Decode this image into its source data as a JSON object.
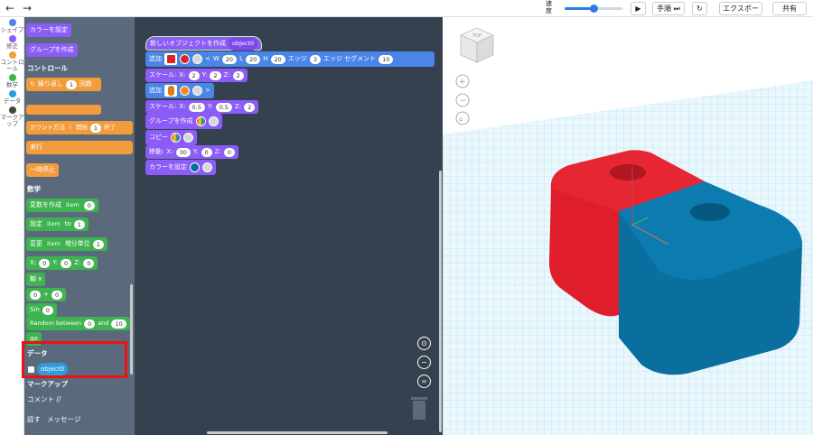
{
  "toolbar": {
    "undo_icon": "undo-arrow-icon",
    "redo_icon": "redo-arrow-icon",
    "speed_label": "速度",
    "speed_value": 0.5,
    "play_icon": "play-icon",
    "step_label": "手順",
    "reset_icon": "reset-icon",
    "export_label": "エクスポート",
    "share_label": "共有"
  },
  "sidebar": {
    "categories": [
      {
        "label": "シェイプ",
        "color": "#4a86e8"
      },
      {
        "label": "修正",
        "color": "#8b5cf6"
      },
      {
        "label": "コントロール",
        "color": "#f39c3c"
      },
      {
        "label": "数学",
        "color": "#3fb34f"
      },
      {
        "label": "データ",
        "color": "#2d9cdb"
      },
      {
        "label": "マークアップ",
        "color": "#444444"
      }
    ]
  },
  "palette": {
    "set_color": "カラーを設定",
    "group_create": "グループを作成",
    "control_header": "コントロール",
    "repeat": "繰り返し",
    "repeat_count": "1",
    "repeat_unit": "回数",
    "count_with": "カウント方法",
    "count_var": "i",
    "count_start_label": "開始",
    "count_start": "1",
    "count_end_label": "終了",
    "run": "実行",
    "pause": "一時停止",
    "math_header": "数学",
    "var_create": "変数を作成",
    "var_item": "item",
    "var_create_value": "0",
    "set": "設定",
    "set_to": "to",
    "set_value": "1",
    "change": "変更",
    "change_by": "増分単位",
    "change_value": "1",
    "xyz_x": "X:",
    "xyz_x_val": "0",
    "xyz_y": "Y:",
    "xyz_y_val": "0",
    "xyz_z": "Z:",
    "xyz_z_val": "0",
    "axis": "軸 x",
    "op_left": "0",
    "op": "+",
    "op_right": "0",
    "sin": "Sin",
    "sin_value": "0",
    "random": "Random between",
    "random_from": "0",
    "random_and": "and",
    "random_to": "10",
    "go": "go",
    "data_header": "データ",
    "data_var": "object0",
    "markup_header": "マークアップ",
    "comment": "コメント //",
    "say_label": "話す",
    "say_message": "メッセージ"
  },
  "workspace": {
    "hat_label": "新しいオブジェクトを作成",
    "hat_var": "object0",
    "add_label": "追加",
    "w_label": "W",
    "w_value": "20",
    "l_label": "L",
    "l_value": "20",
    "h_label": "H",
    "h_value": "20",
    "edge_label": "エッジ",
    "edge_value": "3",
    "edge_seg_label": "エッジ セグメント",
    "edge_seg_value": "10",
    "scale_label": "スケール:",
    "sx": "2",
    "sy": "2",
    "sz": "2",
    "add2_label": "追加",
    "scale2_label": "スケール:",
    "s2x": "0.5",
    "s2y": "0.5",
    "s2z": "2",
    "group_label": "グループを作成",
    "copy_label": "コピー",
    "move_label": "移動:",
    "mx": "30",
    "my": "0",
    "mz": "0",
    "setcolor_label": "カラーを設定",
    "x_label": "X:",
    "y_label": "Y:",
    "z_label": "Z:"
  },
  "colors": {
    "red": "#e02424",
    "orange": "#f58a1f",
    "blue_obj": "#0a6f9e",
    "rainbow": [
      "#e53935",
      "#fb8c00",
      "#fdd835",
      "#43a047",
      "#1e88e5",
      "#8e24aa"
    ]
  },
  "view": {
    "cube_label": "TOP",
    "zoom_in_icon": "plus-icon",
    "zoom_out_icon": "minus-icon",
    "home_icon": "home-icon"
  }
}
